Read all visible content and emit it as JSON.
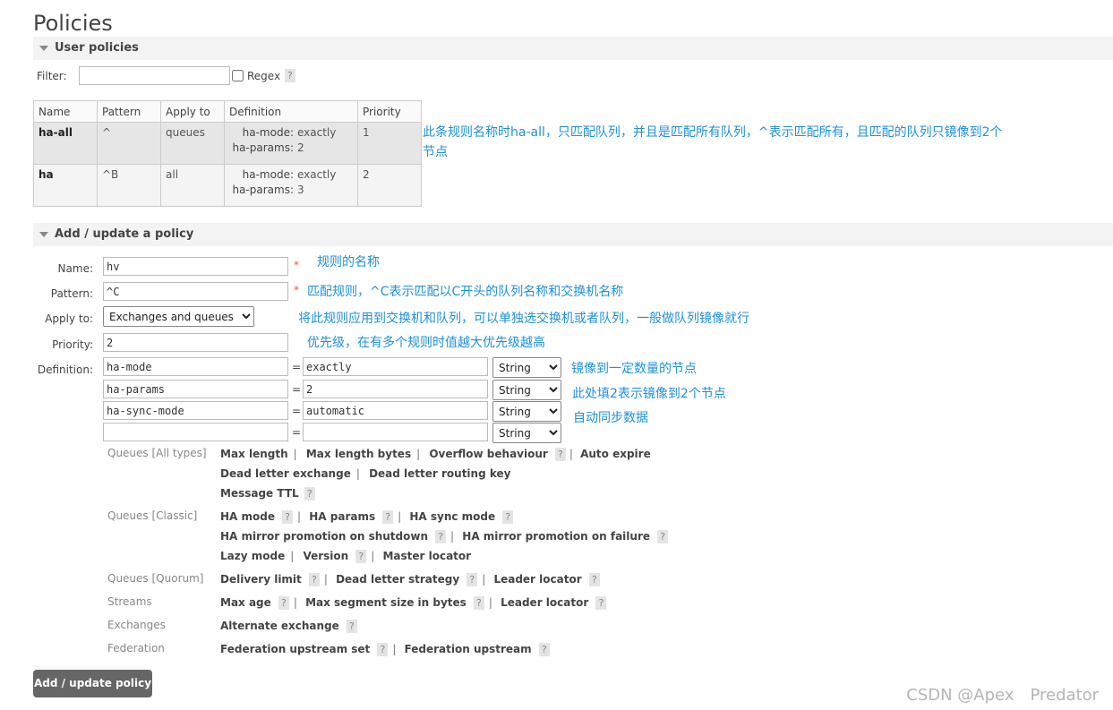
{
  "page_title": "Policies",
  "user_policies": {
    "header": "User policies",
    "filter_label": "Filter:",
    "filter_value": "",
    "regex_label": "Regex",
    "help": "?",
    "columns": [
      "Name",
      "Pattern",
      "Apply to",
      "Definition",
      "Priority"
    ],
    "rows": [
      {
        "name": "ha-all",
        "pattern": "^",
        "apply_to": "queues",
        "def1_key": "ha-mode:",
        "def1_val": "exactly",
        "def2_key": "ha-params:",
        "def2_val": "2",
        "priority": "1"
      },
      {
        "name": "ha",
        "pattern": "^B",
        "apply_to": "all",
        "def1_key": "ha-mode:",
        "def1_val": "exactly",
        "def2_key": "ha-params:",
        "def2_val": "3",
        "priority": "2"
      }
    ],
    "annotation_line1": "此条规则名称时ha-all，只匹配队列，并且是匹配所有队列，^表示匹配所有，且匹配的队列只镜像到2个",
    "annotation_line2": "节点"
  },
  "add_policy": {
    "header": "Add / update a policy",
    "name_label": "Name:",
    "name_value": "hv",
    "pattern_label": "Pattern:",
    "pattern_value": "^C",
    "apply_label": "Apply to:",
    "apply_value": "Exchanges and queues",
    "priority_label": "Priority:",
    "priority_value": "2",
    "definition_label": "Definition:",
    "required_mark": "*",
    "eq": "=",
    "definitions": [
      {
        "key": "ha-mode",
        "value": "exactly",
        "type": "String"
      },
      {
        "key": "ha-params",
        "value": "2",
        "type": "String"
      },
      {
        "key": "ha-sync-mode",
        "value": "automatic",
        "type": "String"
      },
      {
        "key": "",
        "value": "",
        "type": "String"
      }
    ],
    "annotations": {
      "name": "规则的名称",
      "pattern": "匹配规则，^C表示匹配以C开头的队列名称和交换机名称",
      "apply": "将此规则应用到交换机和队列，可以单独选交换机或者队列，一般做队列镜像就行",
      "priority": "优先级，在有多个规则时值越大优先级越高",
      "def1": "镜像到一定数量的节点",
      "def2": "此处填2表示镜像到2个节点",
      "def3": "自动同步数据"
    },
    "categories": {
      "all_types": "Queues [All types]",
      "classic": "Queues [Classic]",
      "quorum": "Queues [Quorum]",
      "streams": "Streams",
      "exchanges": "Exchanges",
      "federation": "Federation"
    },
    "options": {
      "max_length": "Max length",
      "max_length_bytes": "Max length bytes",
      "overflow_behaviour": "Overflow behaviour",
      "auto_expire": "Auto expire",
      "dead_letter_exchange": "Dead letter exchange",
      "dead_letter_routing_key": "Dead letter routing key",
      "message_ttl": "Message TTL",
      "ha_mode": "HA mode",
      "ha_params": "HA params",
      "ha_sync_mode": "HA sync mode",
      "ha_promo_shutdown": "HA mirror promotion on shutdown",
      "ha_promo_failure": "HA mirror promotion on failure",
      "lazy_mode": "Lazy mode",
      "version": "Version",
      "master_locator": "Master locator",
      "delivery_limit": "Delivery limit",
      "dead_letter_strategy": "Dead letter strategy",
      "leader_locator_q": "Leader locator",
      "max_age": "Max age",
      "max_segment": "Max segment size in bytes",
      "leader_locator_s": "Leader locator",
      "alternate_exchange": "Alternate exchange",
      "fed_upstream_set": "Federation upstream set",
      "fed_upstream": "Federation upstream"
    },
    "submit_label": "Add / update policy"
  },
  "watermark": "CSDN @Apex　Predator"
}
